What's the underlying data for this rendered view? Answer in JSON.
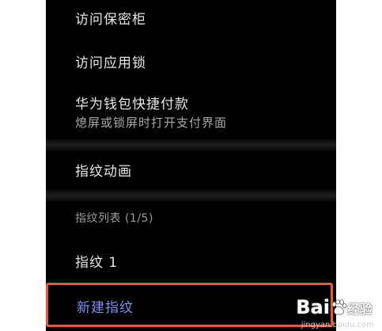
{
  "settings": {
    "items": [
      {
        "label": "访问保密柜"
      },
      {
        "label": "访问应用锁"
      },
      {
        "label": "华为钱包快捷付款",
        "subtitle": "熄屏或锁屏时打开支付界面"
      }
    ],
    "animation_item": {
      "label": "指纹动画"
    },
    "fingerprint_list": {
      "header": "指纹列表 (1/5)",
      "items": [
        {
          "label": "指纹 1"
        }
      ],
      "new_label": "新建指纹"
    }
  },
  "colors": {
    "highlight_border": "#e8573a",
    "new_label": "#7c8ff0"
  },
  "watermark": {
    "logo_text": "Bai",
    "logo_text_2": "经验",
    "url": "jingyan.baidu.com",
    "icon": "baidu-paw-icon"
  }
}
